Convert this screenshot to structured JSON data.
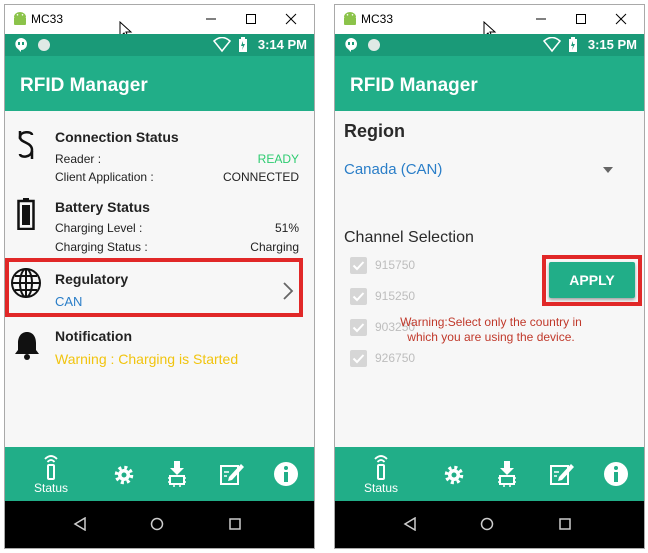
{
  "window": {
    "title": "MC33"
  },
  "left": {
    "status_time": "3:14 PM",
    "app_title": "RFID Manager",
    "connection": {
      "title": "Connection Status",
      "reader_label": "Reader :",
      "reader_value": "READY",
      "client_label": "Client Application :",
      "client_value": "CONNECTED"
    },
    "battery": {
      "title": "Battery Status",
      "level_label": "Charging Level :",
      "level_value": "51%",
      "status_label": "Charging Status :",
      "status_value": "Charging"
    },
    "regulatory": {
      "title": "Regulatory",
      "value": "CAN"
    },
    "notification": {
      "title": "Notification",
      "message": "Warning : Charging is Started"
    },
    "nav": {
      "status_label": "Status"
    }
  },
  "right": {
    "status_time": "3:15 PM",
    "app_title": "RFID Manager",
    "region": {
      "title": "Region",
      "selected": "Canada (CAN)"
    },
    "channel": {
      "title": "Channel Selection",
      "items": [
        "915750",
        "915250",
        "903250",
        "926750"
      ]
    },
    "apply_label": "APPLY",
    "warning_line1": "Warning:Select only the country in",
    "warning_line2": "which you are using the device.",
    "nav": {
      "status_label": "Status"
    }
  },
  "colors": {
    "status_bar": "#1a9a78",
    "app_bar": "#21ae88",
    "ready": "#2ecc71",
    "link": "#2a7ec8",
    "warning_yellow": "#f1c40f",
    "warning_red": "#c0392b",
    "highlight": "#e12828"
  },
  "icons": {
    "status_bar": [
      "hangouts-icon",
      "circle-icon",
      "wifi-icon",
      "battery-charging-icon"
    ],
    "bottom_nav": [
      "rfid-status-icon",
      "gear-icon",
      "download-chip-icon",
      "edit-icon",
      "info-icon"
    ],
    "system_nav": [
      "back-icon",
      "home-icon",
      "recents-icon"
    ]
  }
}
